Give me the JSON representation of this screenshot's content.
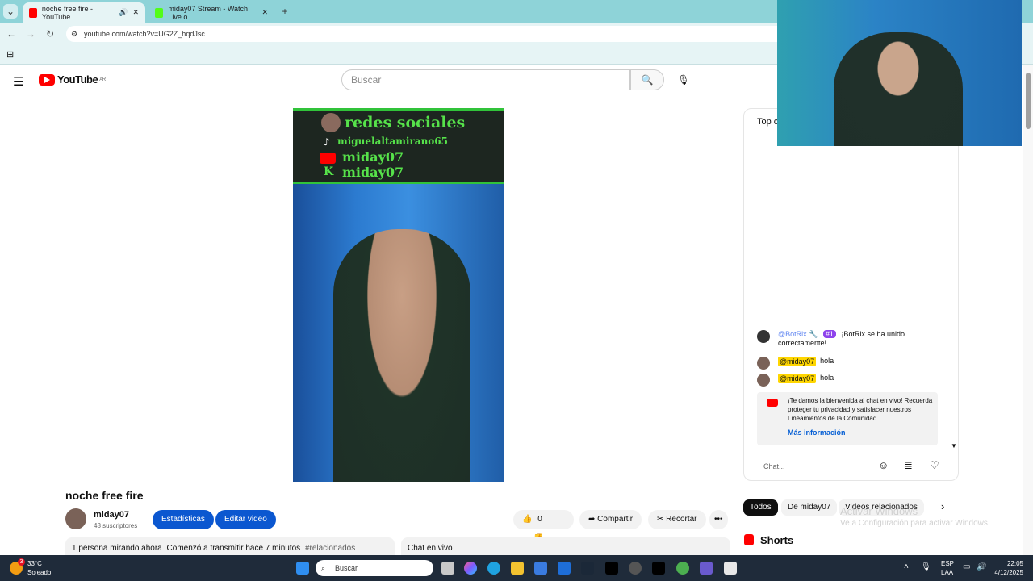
{
  "browser": {
    "tabs": [
      {
        "title": "noche free fire - YouTube",
        "active": true
      },
      {
        "title": "miday07 Stream - Watch Live o",
        "active": false
      }
    ],
    "url": "youtube.com/watch?v=UG2Z_hqdJsc",
    "new_tab": "+"
  },
  "youtube": {
    "logo": "YouTube",
    "region": "AR",
    "search_placeholder": "Buscar",
    "video": {
      "banner_title": "redes sociales",
      "tiktok": "miguelaltamirano65",
      "youtube": "miday07",
      "kick": "miday07"
    },
    "title": "noche free fire",
    "channel": {
      "name": "miday07",
      "subs": "48 suscriptores"
    },
    "buttons": {
      "stats": "Estadísticas",
      "edit": "Editar video",
      "likes": "0",
      "share": "Compartir",
      "clip": "Recortar",
      "more": "•••"
    },
    "description": {
      "views": "1 persona mirando ahora",
      "started": "Comenzó a transmitir hace 7 minutos",
      "tag": "#relacionados"
    },
    "chat_replay_label": "Chat en vivo",
    "chat": {
      "header": "Top c",
      "messages": [
        {
          "author": "@BotRix",
          "badge": "#1",
          "text": "¡BotRix se ha unido",
          "text2": "correctamente!"
        },
        {
          "author": "@miday07",
          "text": "hola"
        },
        {
          "author": "@miday07",
          "text": "hola"
        }
      ],
      "notice": "¡Te damos la bienvenida al chat en vivo! Recuerda proteger tu privacidad y satisfacer nuestros Lineamientos de la Comunidad.",
      "notice_link": "Más información",
      "input_placeholder": "Chat..."
    },
    "chips": [
      "Todos",
      "De miday07",
      "Videos relacionados"
    ],
    "shorts_label": "Shorts",
    "watermark1": "Activar Windows",
    "watermark2": "Ve a Configuración para activar Windows."
  },
  "taskbar": {
    "weather_temp": "33°C",
    "weather_desc": "Soleado",
    "weather_badge": "3",
    "search": "Buscar",
    "lang1": "ESP",
    "lang2": "LAA",
    "time": "22:05",
    "date": "4/12/2025"
  },
  "colors": {
    "tabbar": "#8ed3d8",
    "accent_blue": "#0b57d0",
    "yt_red": "#ff0000",
    "taskbar": "#1f2b3a"
  }
}
